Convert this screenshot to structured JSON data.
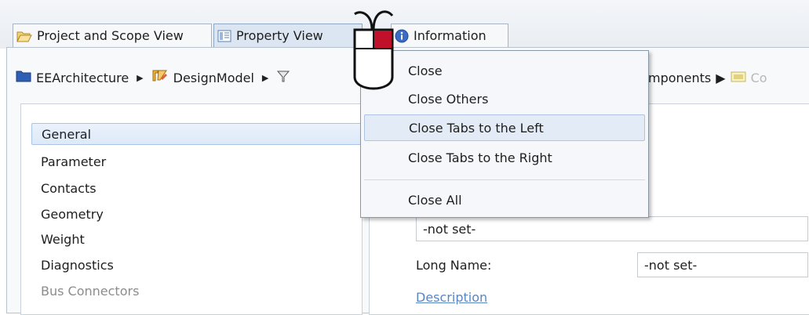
{
  "tabs": [
    {
      "label": "Project and Scope View",
      "icon": "folder-open-icon"
    },
    {
      "label": "Property View",
      "icon": "property-view-icon"
    },
    {
      "label": "Information",
      "icon": "info-icon"
    }
  ],
  "breadcrumb": {
    "items": [
      "EEArchitecture",
      "DesignModel"
    ],
    "trailing": [
      "mponents",
      "Co"
    ]
  },
  "sidebar": {
    "items": [
      {
        "label": "General",
        "selected": true
      },
      {
        "label": "Parameter"
      },
      {
        "label": "Contacts"
      },
      {
        "label": "Geometry"
      },
      {
        "label": "Weight"
      },
      {
        "label": "Diagnostics"
      },
      {
        "label": "Bus Connectors",
        "disabled": true
      }
    ]
  },
  "form": {
    "name_value": "-not set-",
    "long_name_label": "Long Name:",
    "long_name_value": "-not set-",
    "description_link": "Description"
  },
  "context_menu": {
    "items": [
      "Close",
      "Close Others",
      "Close Tabs to the Left",
      "Close Tabs to the Right",
      "Close All"
    ],
    "hovered": "Close Tabs to the Left"
  },
  "colors": {
    "mouse_button_highlight": "#c0102a",
    "selection": "#dde9f8",
    "link": "#5b86c4"
  }
}
